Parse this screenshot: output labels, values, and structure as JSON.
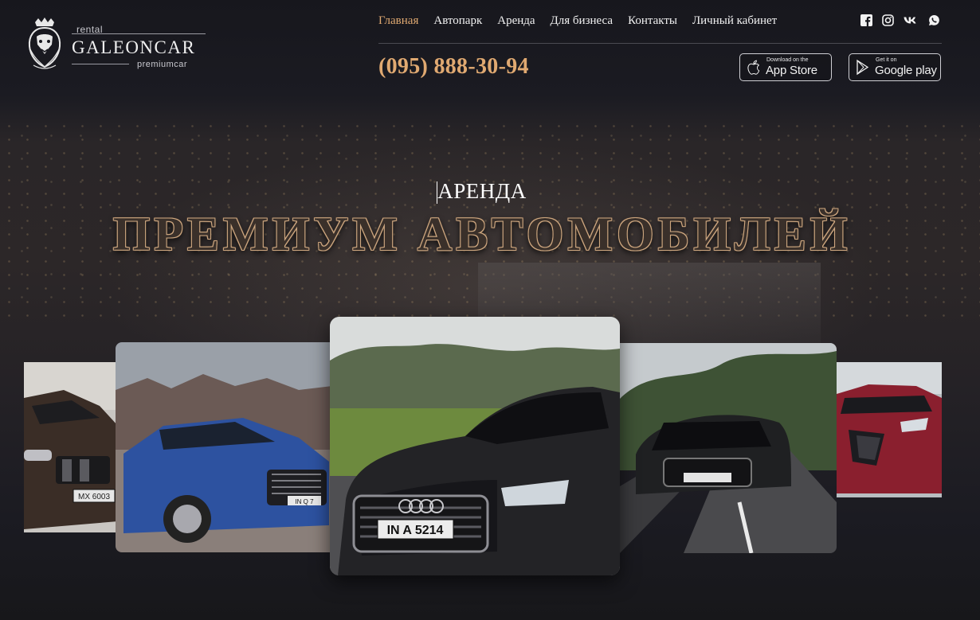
{
  "logo": {
    "rental": "rental",
    "name": "GALEONCAR",
    "premium": "premiumcar",
    "emblem_icon": "lion-crest-icon"
  },
  "nav": {
    "items": [
      {
        "label": "Главная",
        "active": true
      },
      {
        "label": "Автопарк",
        "active": false
      },
      {
        "label": "Аренда",
        "active": false
      },
      {
        "label": "Для бизнеса",
        "active": false
      },
      {
        "label": "Контакты",
        "active": false
      },
      {
        "label": "Личный кабинет",
        "active": false
      }
    ]
  },
  "socials": [
    "facebook-icon",
    "instagram-icon",
    "vk-icon",
    "whatsapp-icon"
  ],
  "phone": "(095) 888-30-94",
  "stores": {
    "app_store": {
      "small": "Download on the",
      "big": "App Store"
    },
    "google_play": {
      "small": "Get it on",
      "big": "Google play"
    }
  },
  "hero": {
    "subtitle": "АРЕНДА",
    "title": "ПРЕМИУМ АВТОМОБИЛЕЙ"
  },
  "cars": {
    "plates": {
      "far_left": "MX 6003",
      "left": "IN Q 7",
      "center": "IN A 5214"
    }
  },
  "colors": {
    "accent": "#e0a971",
    "background": "#17171d",
    "text": "#f2f2f2"
  }
}
